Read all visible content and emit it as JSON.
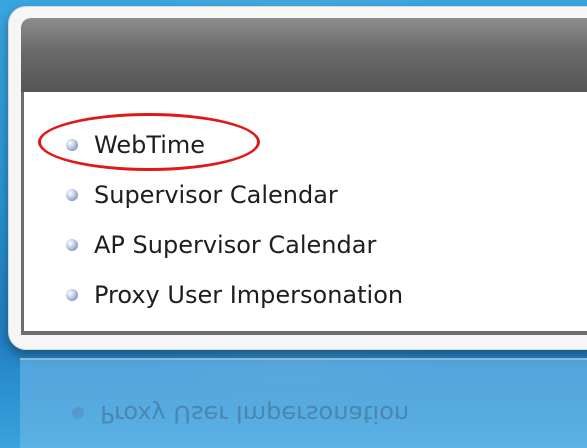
{
  "menu": {
    "items": [
      {
        "label": "WebTime",
        "highlighted": true
      },
      {
        "label": "Supervisor Calendar"
      },
      {
        "label": "AP Supervisor Calendar"
      },
      {
        "label": "Proxy User Impersonation"
      }
    ]
  },
  "reflection": {
    "label": "Proxy User Impersonation"
  },
  "colors": {
    "background": "#2b93d3",
    "header": "#6a6a6a",
    "highlight": "#e01818"
  },
  "icons": {
    "bullet": "bullet-icon"
  }
}
